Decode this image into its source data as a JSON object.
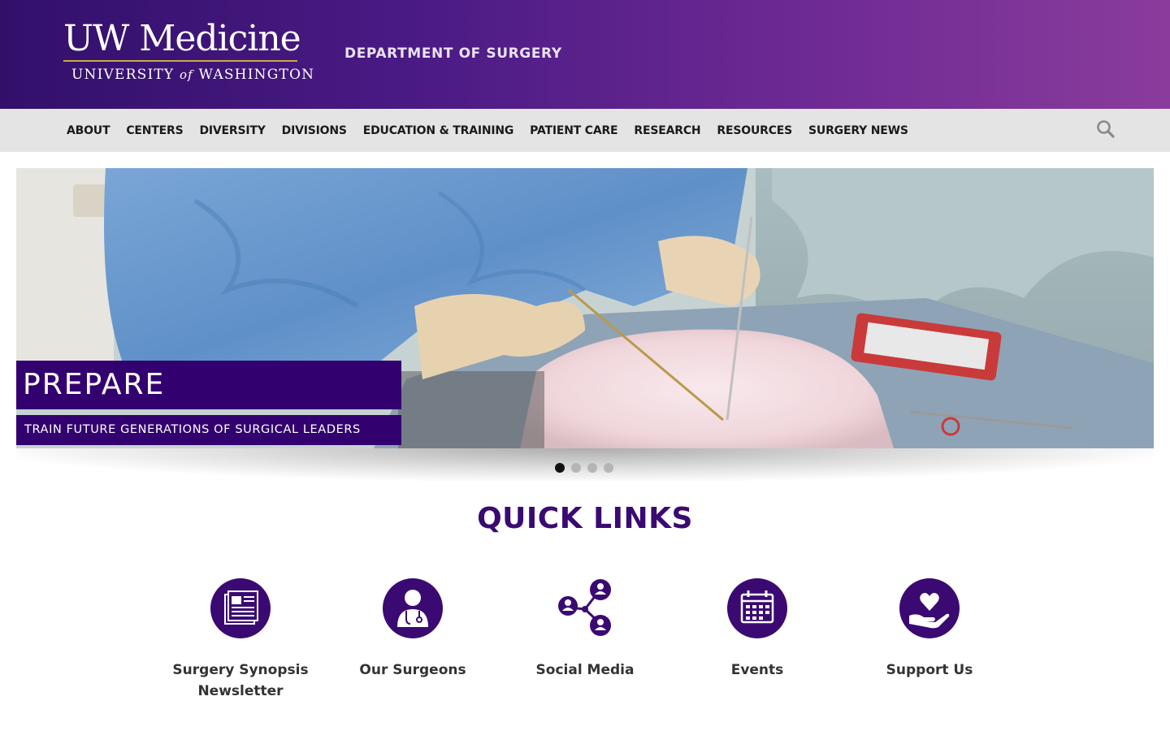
{
  "header": {
    "logo_main": "UW Medicine",
    "logo_sub_pre": "UNIVERSITY ",
    "logo_sub_of": "of",
    "logo_sub_post": " WASHINGTON",
    "department": "DEPARTMENT OF SURGERY"
  },
  "nav": {
    "items": [
      {
        "label": "ABOUT"
      },
      {
        "label": "CENTERS"
      },
      {
        "label": "DIVERSITY"
      },
      {
        "label": "DIVISIONS"
      },
      {
        "label": "EDUCATION & TRAINING"
      },
      {
        "label": "PATIENT CARE"
      },
      {
        "label": "RESEARCH"
      },
      {
        "label": "RESOURCES"
      },
      {
        "label": "SURGERY NEWS"
      }
    ],
    "search_icon": "search-icon"
  },
  "hero": {
    "title": "PREPARE",
    "subtitle": "TRAIN FUTURE GENERATIONS OF SURGICAL LEADERS",
    "slide_count": 4,
    "active_slide": 1
  },
  "quick_links": {
    "title": "QUICK LINKS",
    "items": [
      {
        "label_line1": "Surgery Synopsis",
        "label_line2": "Newsletter",
        "icon": "newspaper-icon"
      },
      {
        "label_line1": "Our Surgeons",
        "label_line2": "",
        "icon": "surgeon-icon"
      },
      {
        "label_line1": "Social Media",
        "label_line2": "",
        "icon": "social-network-icon"
      },
      {
        "label_line1": "Events",
        "label_line2": "",
        "icon": "calendar-icon"
      },
      {
        "label_line1": "Support Us",
        "label_line2": "",
        "icon": "heart-hand-icon"
      }
    ]
  },
  "colors": {
    "brand_purple": "#33006f",
    "header_gradient_start": "#32106a",
    "header_gradient_end": "#8a3c9c",
    "gold": "#c9a94a",
    "nav_bg": "#e4e4e4"
  }
}
